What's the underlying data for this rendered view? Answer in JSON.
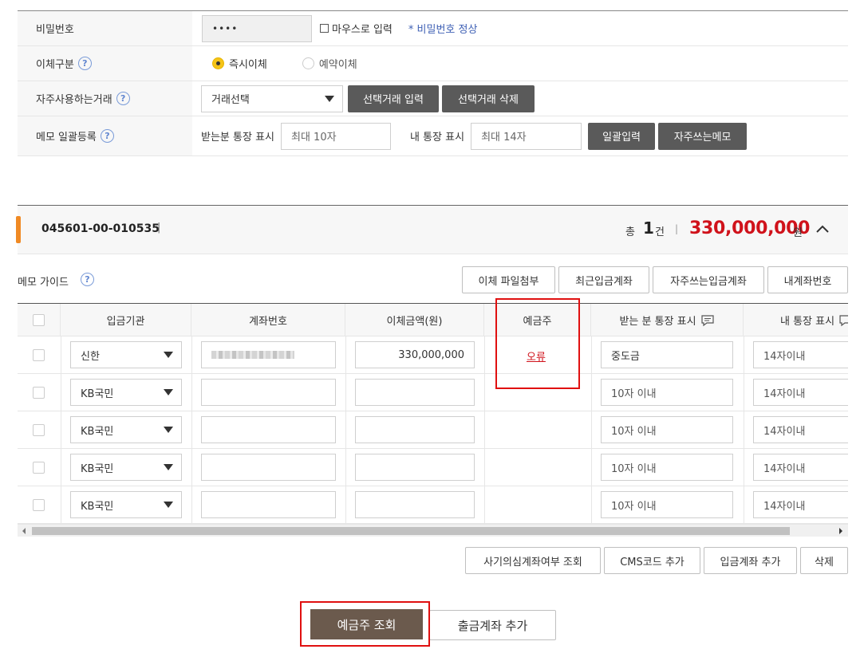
{
  "settings": {
    "password": {
      "label": "비밀번호",
      "value": "••••",
      "mouse_input_label": "마우스로 입력",
      "status": "* 비밀번호 정상"
    },
    "transfer_type": {
      "label": "이체구분",
      "help": "?",
      "options": [
        "즉시이체",
        "예약이체"
      ],
      "selected": "즉시이체"
    },
    "frequent": {
      "label": "자주사용하는거래",
      "help": "?",
      "select_value": "거래선택",
      "btn_input": "선택거래 입력",
      "btn_delete": "선택거래 삭제"
    },
    "memo": {
      "label": "메모 일괄등록",
      "help": "?",
      "receiver_label": "받는분 통장 표시",
      "receiver_placeholder": "최대 10자",
      "my_label": "내 통장 표시",
      "my_placeholder": "최대 14자",
      "btn_bulk": "일괄입력",
      "btn_frequent": "자주쓰는메모"
    }
  },
  "account": {
    "number": "045601-00-010535",
    "divider": "|",
    "total_prefix": "총",
    "count": "1",
    "count_unit": "건",
    "sep": "|",
    "amount": "330,000,000",
    "amount_unit": "원",
    "collapse_icon": "chevron-up-icon"
  },
  "memo_guide": {
    "label": "메모 가이드",
    "help": "?"
  },
  "top_buttons": [
    "이체 파일첨부",
    "최근입금계좌",
    "자주쓰는입금계좌",
    "내계좌번호"
  ],
  "table": {
    "headers": [
      "입금기관",
      "계좌번호",
      "이체금액(원)",
      "예금주",
      "받는 분 통장 표시",
      "내 통장 표시"
    ],
    "rows": [
      {
        "bank": "신한",
        "account": "",
        "amount": "330,000,000",
        "holder": "오류",
        "recv_memo": "중도금",
        "my_memo": "14자이내"
      },
      {
        "bank": "KB국민",
        "account": "",
        "amount": "",
        "holder": "",
        "recv_memo": "10자 이내",
        "my_memo": "14자이내"
      },
      {
        "bank": "KB국민",
        "account": "",
        "amount": "",
        "holder": "",
        "recv_memo": "10자 이내",
        "my_memo": "14자이내"
      },
      {
        "bank": "KB국민",
        "account": "",
        "amount": "",
        "holder": "",
        "recv_memo": "10자 이내",
        "my_memo": "14자이내"
      },
      {
        "bank": "KB국민",
        "account": "",
        "amount": "",
        "holder": "",
        "recv_memo": "10자 이내",
        "my_memo": "14자이내"
      }
    ]
  },
  "bottom_buttons": [
    "사기의심계좌여부 조회",
    "CMS코드 추가",
    "입금계좌 추가",
    "삭제"
  ],
  "actions": {
    "primary": "예금주 조회",
    "secondary": "출금계좌 추가"
  },
  "colors": {
    "accent_orange": "#f08a24",
    "amount_red": "#d0121b",
    "error_red": "#d0121b",
    "primary_btn": "#6b5a4d",
    "highlight": "#e01010"
  }
}
